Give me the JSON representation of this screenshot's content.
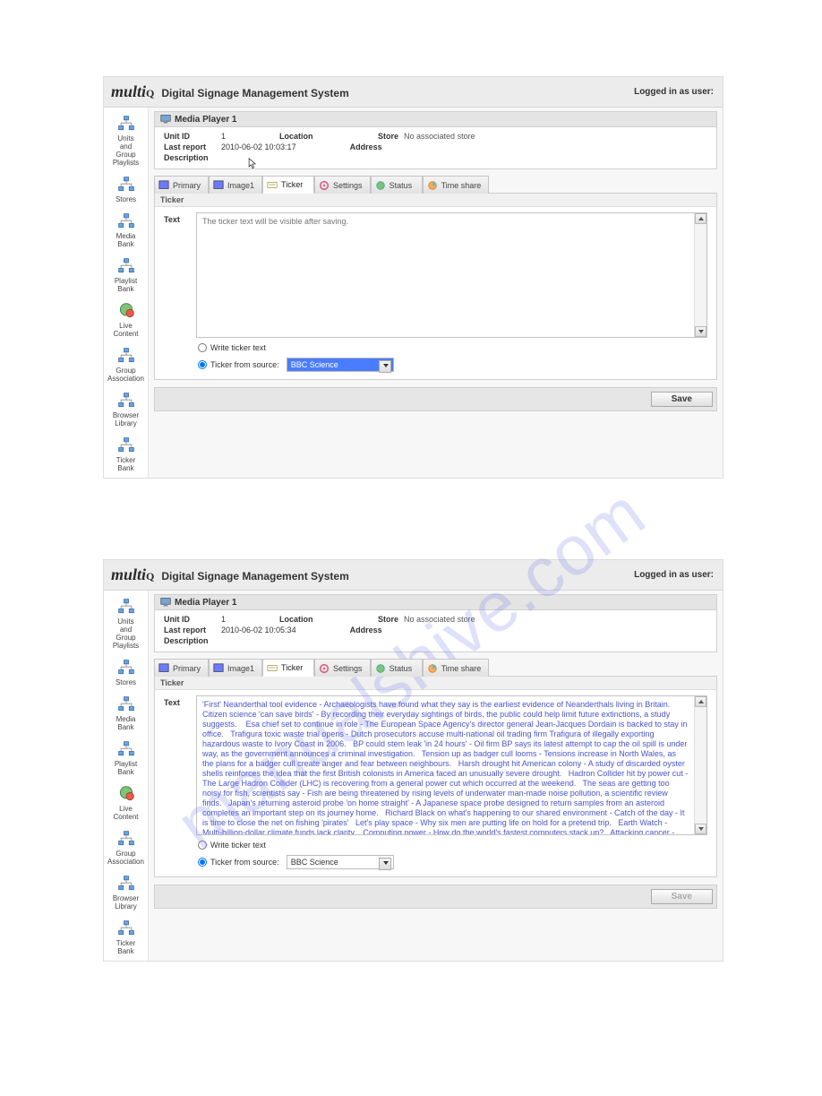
{
  "watermark": "manualshive.com",
  "header": {
    "logo": "multiQ",
    "title": "Digital Signage Management System",
    "login_label": "Logged in as user:"
  },
  "sidebar": {
    "items": [
      {
        "label": "Units\nand\nGroup\nPlaylists"
      },
      {
        "label": "Stores"
      },
      {
        "label": "Media\nBank"
      },
      {
        "label": "Playlist\nBank"
      },
      {
        "label": "Live\nContent"
      },
      {
        "label": "Group\nAssociation"
      },
      {
        "label": "Browser\nLibrary"
      },
      {
        "label": "Ticker\nBank"
      }
    ]
  },
  "tabs": [
    {
      "label": "Primary"
    },
    {
      "label": "Image1"
    },
    {
      "label": "Ticker"
    },
    {
      "label": "Settings"
    },
    {
      "label": "Status"
    },
    {
      "label": "Time share"
    }
  ],
  "panel_title": "Media Player 1",
  "info": {
    "unit_id_label": "Unit ID",
    "unit_id_value": "1",
    "location_label": "Location",
    "store_label": "Store",
    "store_value": "No associated store",
    "last_report_label": "Last report",
    "address_label": "Address",
    "description_label": "Description"
  },
  "ticker_section_label": "Ticker",
  "ticker_text_label": "Text",
  "radio_write": "Write ticker text",
  "radio_source": "Ticker from source:",
  "source_value": "BBC Science",
  "save_label": "Save",
  "screen1": {
    "last_report": "2010-06-02 10:03:17",
    "ticker_placeholder": "The ticker text will be visible after saving."
  },
  "screen2": {
    "last_report": "2010-06-02 10:05:34",
    "ticker_text": "'First' Neanderthal tool evidence - Archaeologists have found what they say is the earliest evidence of Neanderthals living in Britain.    Citizen science 'can save birds' - By recording their everyday sightings of birds, the public could help limit future extinctions, a study suggests.    Esa chief set to continue in role - The European Space Agency's director general Jean-Jacques Dordain is backed to stay in office.   Trafigura toxic waste trial opens - Dutch prosecutors accuse multi-national oil trading firm Trafigura of illegally exporting hazardous waste to Ivory Coast in 2006.   BP could stem leak 'in 24 hours' - Oil firm BP says its latest attempt to cap the oil spill is under way, as the government announces a criminal investigation.   Tension up as badger cull looms - Tensions increase in North Wales, as the plans for a badger cull create anger and fear between neighbours.   Harsh drought hit American colony - A study of discarded oyster shells reinforces the idea that the first British colonists in America faced an unusually severe drought.   Hadron Collider hit by power cut - The Large Hadron Collider (LHC) is recovering from a general power cut which occurred at the weekend.   The seas are getting too noisy for fish, scientists say - Fish are being threatened by rising levels of underwater man-made noise pollution, a scientific review finds.   Japan's returning asteroid probe 'on home straight' - A Japanese space probe designed to return samples from an asteroid completes an important step on its journey home.   Richard Black on what's happening to our shared environment - Catch of the day - It is time to close the net on fishing 'pirates'   Let's play space - Why six men are putting life on hold for a pretend trip.   Earth Watch - Multi-billion-dollar climate funds lack clarity.   Computing power - How do the world's fastest computers stack up?   Attacking cancer - Genetic research paves way to new approach.   Harrabin's Notes - Royal Society under fire over climate statements.   Whales and dolphins - 'resource' or 'right'? - Discoveries of sophisticated intelligence in cetaceans raise new questions about how we relate to them - including whether we should hunt them.   Choices we need to make on oil - The Gulf of Mexico oil leak raises deep questions over the environmental cost of our \"addiction\" to oil.   How hedgehogs live the town life - Female hedgehogs prefer gardens of semi-detached and terraced houses, finds the first study of how they have adapted to urban life.   Close encounter with a bizarre venomous beast - A close encounter with one of the world's weirdest mammals - the Hispaniolan solenodon.   'Space laser tech needed' on ash - Europe requires space-borne laser instruments that can provide information on volcanic ash clouds, a conference hears.   China pushes supercomputer power - China ramps up efforts to become a"
  }
}
